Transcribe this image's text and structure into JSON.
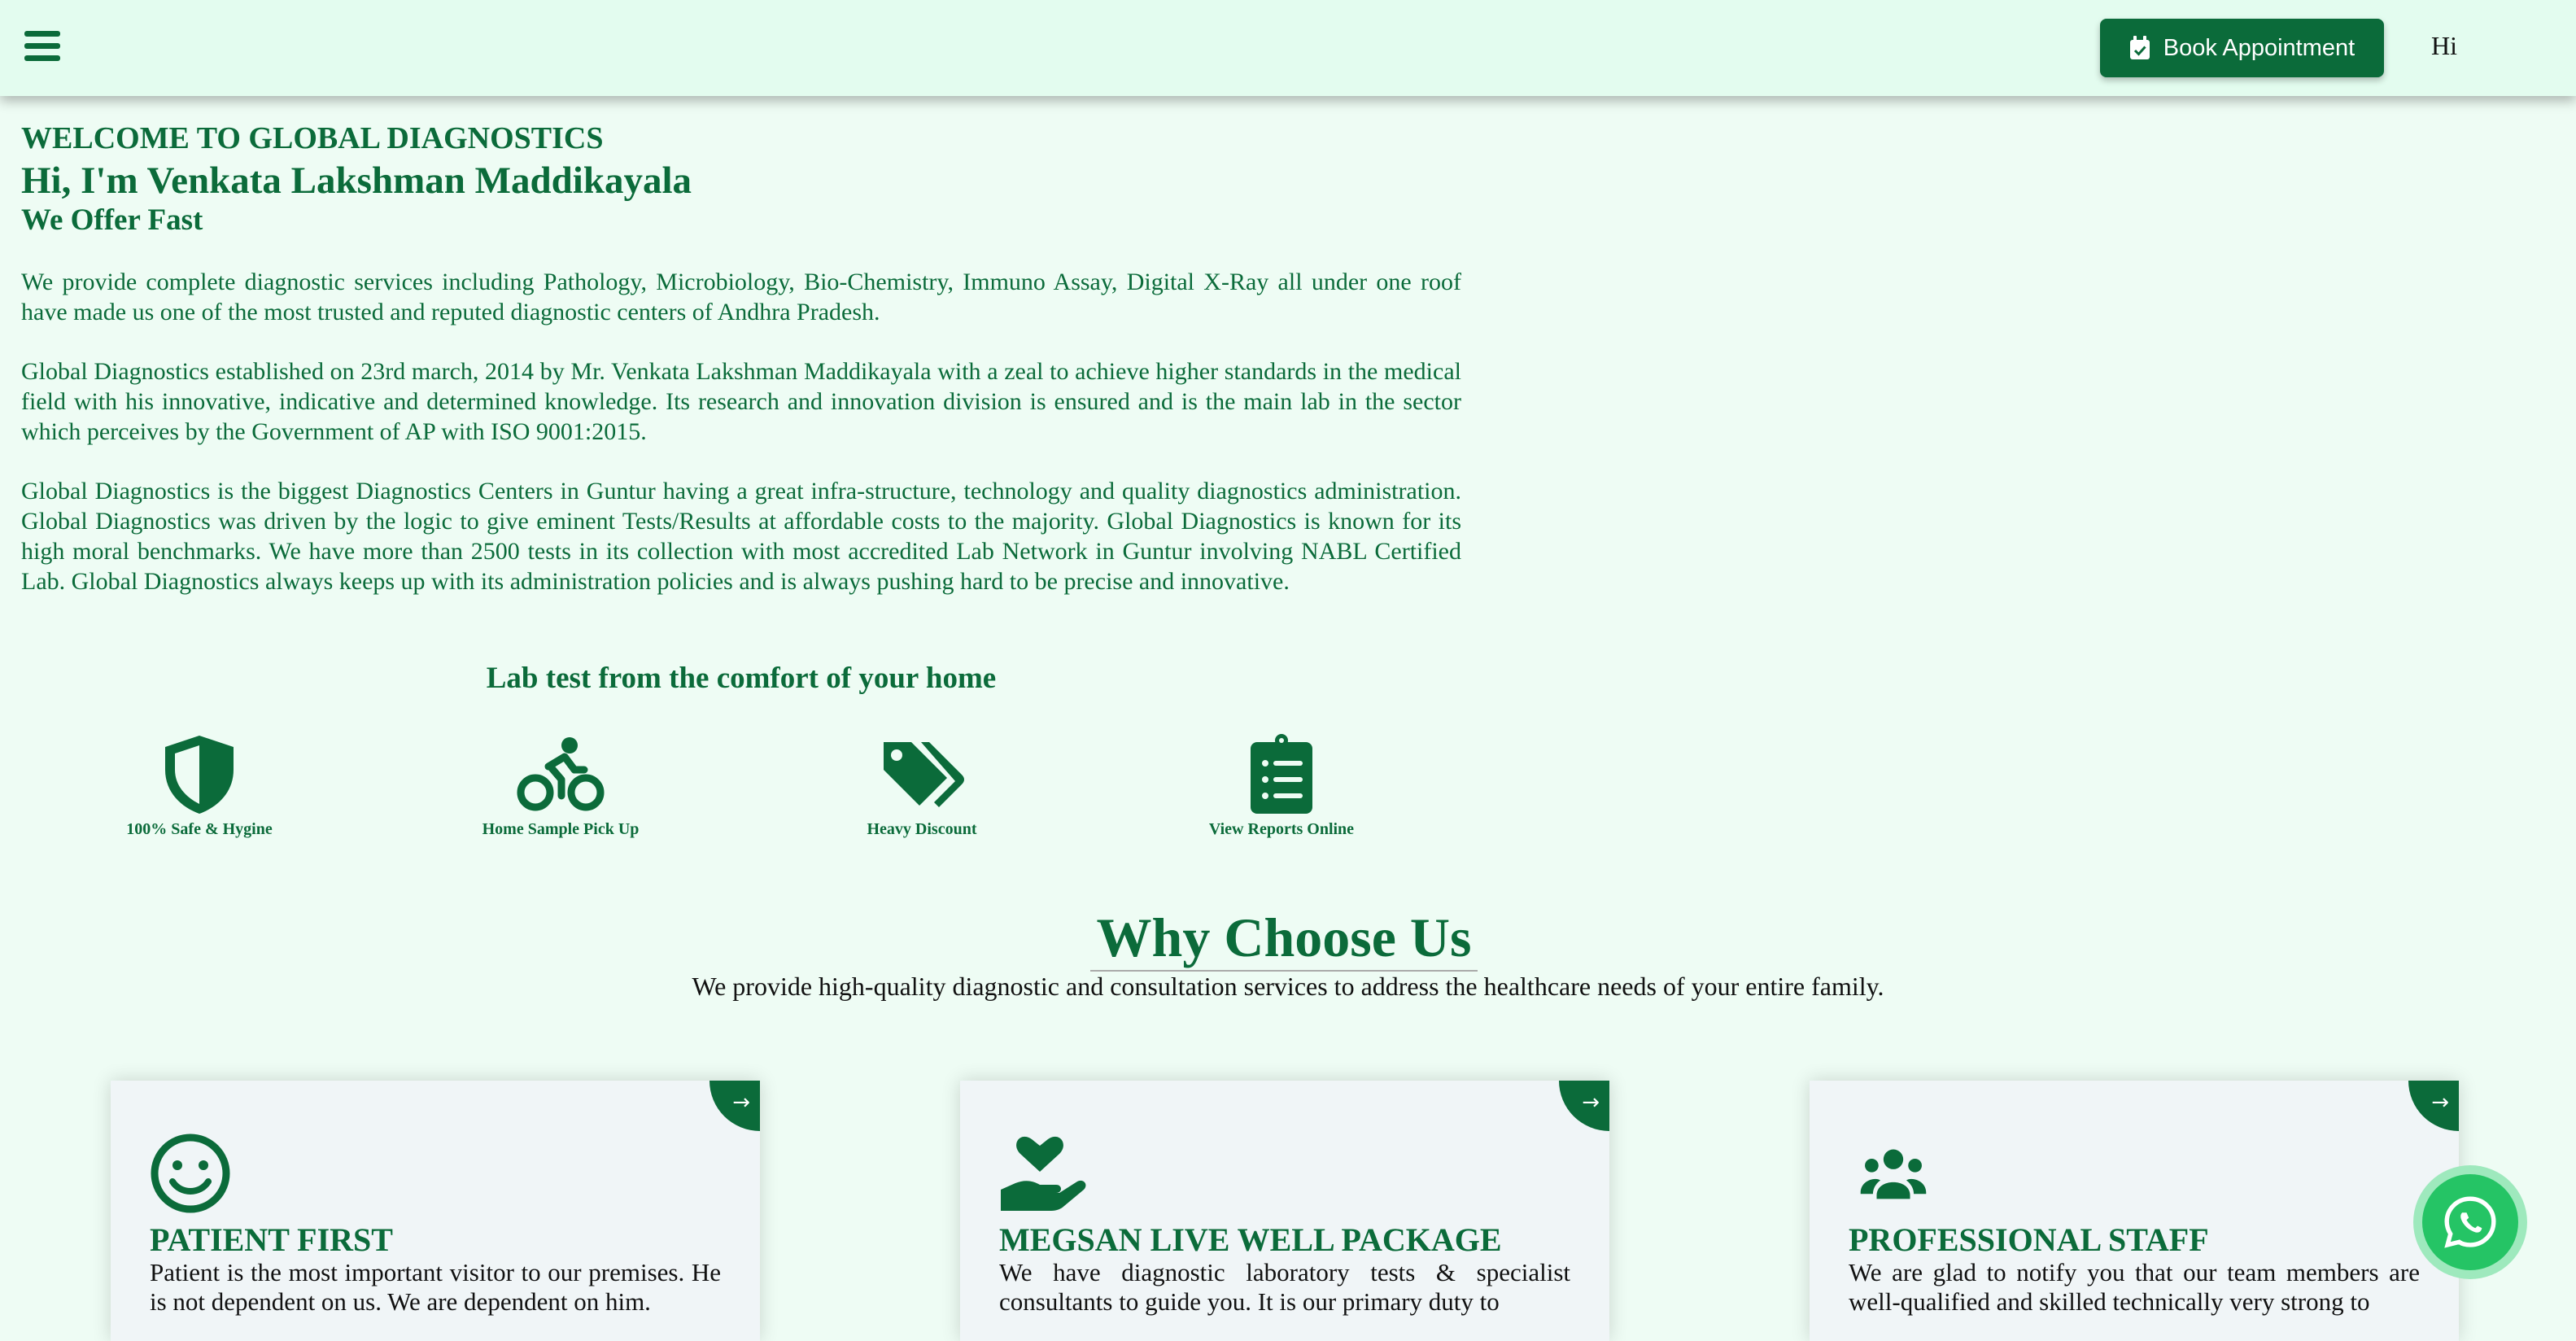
{
  "header": {
    "menu_icon": "hamburger-menu-icon",
    "book_button_icon": "calendar-check-icon",
    "book_button_label": "Book Appointment",
    "user_greeting": "Hi"
  },
  "hero": {
    "welcome": "WELCOME TO GLOBAL DIAGNOSTICS",
    "name": "Hi, I'm Venkata Lakshman Maddikayala",
    "offer": "We Offer Fast",
    "paragraphs": [
      "We provide complete diagnostic services including Pathology, Microbiology, Bio-Chemistry, Immuno Assay, Digital X-Ray all under one roof have made us one of the most trusted and reputed diagnostic centers of Andhra Pradesh.",
      "Global Diagnostics established on 23rd march, 2014 by Mr. Venkata Lakshman Maddikayala with a zeal to achieve higher standards in the medical field with his innovative, indicative and determined knowledge. Its research and innovation division is ensured and is the main lab in the sector which perceives by the Government of AP with ISO 9001:2015.",
      "Global Diagnostics is the biggest Diagnostics Centers in Guntur having a great infra-structure, technology and quality diagnostics administration. Global Diagnostics was driven by the logic to give eminent Tests/Results at affordable costs to the majority. Global Diagnostics is known for its high moral benchmarks. We have more than 2500 tests in its collection with most accredited Lab Network in Guntur involving NABL Certified Lab. Global Diagnostics always keeps up with its administration policies and is always pushing hard to be precise and innovative."
    ]
  },
  "lab_test": {
    "title": "Lab test from the comfort of your home",
    "features": [
      {
        "label": "100% Safe & Hygine",
        "icon": "shield-icon"
      },
      {
        "label": "Home Sample Pick Up",
        "icon": "bicycle-rider-icon"
      },
      {
        "label": "Heavy Discount",
        "icon": "price-tags-icon"
      },
      {
        "label": "View Reports Online",
        "icon": "clipboard-list-icon"
      }
    ]
  },
  "why": {
    "title": "Why Choose Us",
    "subtitle": "We provide high-quality diagnostic and consultation services to address the healthcare needs of your entire family."
  },
  "cards": [
    {
      "title": "PATIENT FIRST",
      "icon": "smile-icon",
      "arrow": "→",
      "text": "Patient is the most important visitor to our premises. He is not dependent on us. We are dependent on him."
    },
    {
      "title": "MEGSAN LIVE WELL PACKAGE",
      "icon": "hand-holding-heart-icon",
      "arrow": "→",
      "text": "We have diagnostic laboratory tests & specialist consultants to guide you. It is our primary duty to"
    },
    {
      "title": "PROFESSIONAL STAFF",
      "icon": "users-group-icon",
      "arrow": "→",
      "text": "We are glad to notify you that our team members are well-qualified and skilled technically very strong to"
    }
  ],
  "whatsapp_icon": "whatsapp-icon",
  "colors": {
    "brand": "#0b6b3a",
    "background": "#eefcf4",
    "header_bg": "#e3fcef",
    "whatsapp": "#25c465"
  }
}
